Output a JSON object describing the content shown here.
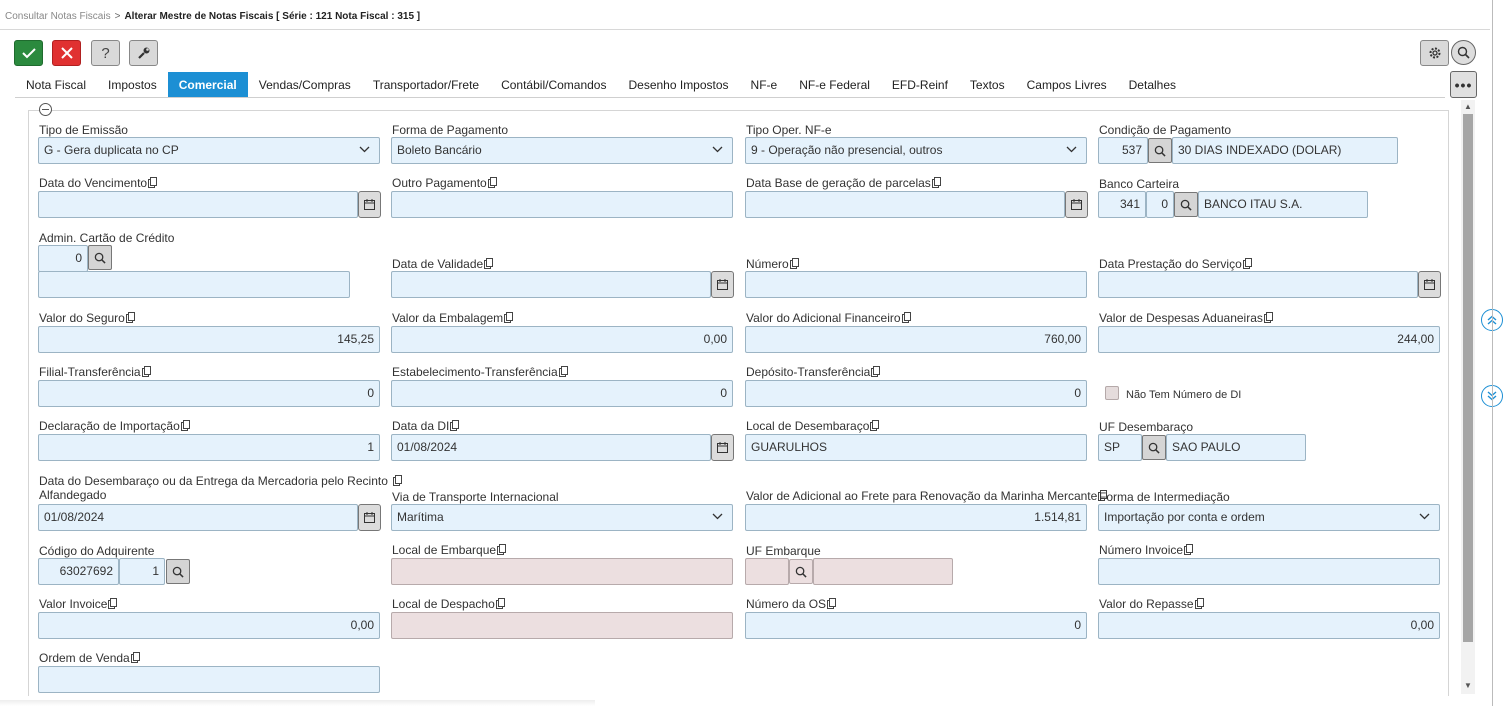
{
  "breadcrumb": {
    "parent": "Consultar Notas Fiscais",
    "separator": ">",
    "current": "Alterar Mestre de Notas Fiscais [ Série : 121 Nota Fiscal : 315 ]"
  },
  "toolbar": {
    "confirm_icon": "check-icon",
    "cancel_icon": "close-icon",
    "help_label": "?",
    "tools_icon": "wrench-icon",
    "settings_icon": "gear-icon",
    "search_icon": "search-icon",
    "more_label": "•••"
  },
  "tabs": [
    {
      "label": "Nota Fiscal"
    },
    {
      "label": "Impostos"
    },
    {
      "label": "Comercial",
      "active": true
    },
    {
      "label": "Vendas/Compras"
    },
    {
      "label": "Transportador/Frete"
    },
    {
      "label": "Contábil/Comandos"
    },
    {
      "label": "Desenho Impostos"
    },
    {
      "label": "NF-e"
    },
    {
      "label": "NF-e Federal"
    },
    {
      "label": "EFD-Reinf"
    },
    {
      "label": "Textos"
    },
    {
      "label": "Campos Livres"
    },
    {
      "label": "Detalhes"
    }
  ],
  "colors": {
    "accent": "#1c8fd4",
    "input_bg": "#e5f2fc",
    "disabled_bg": "#ecdfe0",
    "confirm": "#2b8a3e",
    "cancel": "#e03131"
  },
  "form": {
    "tipo_emissao": {
      "label": "Tipo de Emissão",
      "value": "G - Gera duplicata no CP"
    },
    "forma_pagamento": {
      "label": "Forma de Pagamento",
      "value": "Boleto Bancário"
    },
    "tipo_oper_nfe": {
      "label": "Tipo Oper. NF-e",
      "value": "9 - Operação não presencial, outros"
    },
    "condicao_pagamento": {
      "label": "Condição de Pagamento",
      "code": "537",
      "description": "30 DIAS INDEXADO (DOLAR)"
    },
    "data_vencimento": {
      "label": "Data do Vencimento",
      "value": ""
    },
    "outro_pagamento": {
      "label": "Outro Pagamento",
      "value": ""
    },
    "data_base_parcelas": {
      "label": "Data Base de geração de parcelas",
      "value": ""
    },
    "banco_carteira": {
      "label": "Banco Carteira",
      "bank": "341",
      "wallet": "0",
      "description": "BANCO ITAU S.A."
    },
    "admin_cartao": {
      "label": "Admin. Cartão de Crédito",
      "code": "0",
      "description": ""
    },
    "data_validade": {
      "label": "Data de Validade",
      "value": ""
    },
    "numero": {
      "label": "Número",
      "value": ""
    },
    "data_prestacao": {
      "label": "Data Prestação do Serviço",
      "value": ""
    },
    "valor_seguro": {
      "label": "Valor do Seguro",
      "value": "145,25"
    },
    "valor_embalagem": {
      "label": "Valor da Embalagem",
      "value": "0,00"
    },
    "valor_adicional_financeiro": {
      "label": "Valor do Adicional Financeiro",
      "value": "760,00"
    },
    "valor_despesas_aduaneiras": {
      "label": "Valor de Despesas Aduaneiras",
      "value": "244,00"
    },
    "filial_transferencia": {
      "label": "Filial-Transferência",
      "value": "0"
    },
    "estab_transferencia": {
      "label": "Estabelecimento-Transferência",
      "value": "0"
    },
    "deposito_transferencia": {
      "label": "Depósito-Transferência",
      "value": "0"
    },
    "nao_tem_di": {
      "label": "Não Tem Número de DI",
      "checked": false
    },
    "declaracao_importacao": {
      "label": "Declaração de Importação",
      "value": "1"
    },
    "data_di": {
      "label": "Data da DI",
      "value": "01/08/2024"
    },
    "local_desembaraco": {
      "label": "Local de Desembaraço",
      "value": "GUARULHOS"
    },
    "uf_desembaraco": {
      "label": "UF Desembaraço",
      "code": "SP",
      "description": "SAO PAULO"
    },
    "data_desembaraco": {
      "label_line1": "Data do Desembaraço ou da Entrega da Mercadoria pelo Recinto",
      "label_line2": "Alfandegado",
      "value": "01/08/2024"
    },
    "via_transporte": {
      "label": "Via de Transporte Internacional",
      "value": "Marítima"
    },
    "valor_afrmm": {
      "label": "Valor de Adicional ao Frete para Renovação da Marinha Mercante",
      "value": "1.514,81"
    },
    "forma_intermediacao": {
      "label": "Forma de Intermediação",
      "value": "Importação por conta e ordem"
    },
    "codigo_adquirente": {
      "label": "Código do Adquirente",
      "code": "63027692",
      "seq": "1"
    },
    "local_embarque": {
      "label": "Local de Embarque",
      "value": ""
    },
    "uf_embarque": {
      "label": "UF Embarque",
      "code": "",
      "description": ""
    },
    "numero_invoice": {
      "label": "Número Invoice",
      "value": ""
    },
    "valor_invoice": {
      "label": "Valor Invoice",
      "value": "0,00"
    },
    "local_despacho": {
      "label": "Local de Despacho",
      "value": ""
    },
    "numero_os": {
      "label": "Número da OS",
      "value": "0"
    },
    "valor_repasse": {
      "label": "Valor do Repasse",
      "value": "0,00"
    },
    "ordem_venda": {
      "label": "Ordem de Venda",
      "value": ""
    }
  }
}
